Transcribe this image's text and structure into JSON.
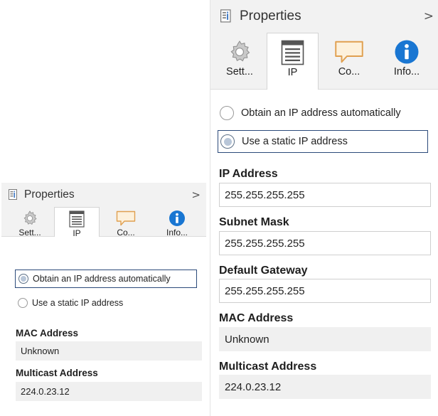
{
  "panels": {
    "small": {
      "header": {
        "title": "Properties",
        "collapse_glyph": ">"
      },
      "tabs": [
        {
          "label": "Sett...",
          "icon": "gear-icon",
          "active": false
        },
        {
          "label": "IP",
          "icon": "ip-config-icon",
          "active": true
        },
        {
          "label": "Co...",
          "icon": "comment-icon",
          "active": false
        },
        {
          "label": "Info...",
          "icon": "info-icon",
          "active": false
        }
      ],
      "radios": {
        "automatic": {
          "label": "Obtain an IP address automatically",
          "checked": true
        },
        "static": {
          "label": "Use a static IP address",
          "checked": false
        }
      },
      "fields": {
        "mac_address": {
          "label": "MAC Address",
          "value": "Unknown"
        },
        "multicast_address": {
          "label": "Multicast Address",
          "value": "224.0.23.12"
        }
      }
    },
    "large": {
      "header": {
        "title": "Properties",
        "collapse_glyph": ">"
      },
      "tabs": [
        {
          "label": "Sett...",
          "icon": "gear-icon",
          "active": false
        },
        {
          "label": "IP",
          "icon": "ip-config-icon",
          "active": true
        },
        {
          "label": "Co...",
          "icon": "comment-icon",
          "active": false
        },
        {
          "label": "Info...",
          "icon": "info-icon",
          "active": false
        }
      ],
      "radios": {
        "automatic": {
          "label": "Obtain an IP address automatically",
          "checked": false
        },
        "static": {
          "label": "Use a static IP address",
          "checked": true
        }
      },
      "fields": {
        "ip_address": {
          "label": "IP Address",
          "value": "255.255.255.255"
        },
        "subnet_mask": {
          "label": "Subnet Mask",
          "value": "255.255.255.255"
        },
        "default_gateway": {
          "label": "Default Gateway",
          "value": "255.255.255.255"
        },
        "mac_address": {
          "label": "MAC Address",
          "value": "Unknown"
        },
        "multicast_address": {
          "label": "Multicast Address",
          "value": "224.0.23.12"
        }
      }
    }
  },
  "colors": {
    "header_bg": "#f2f2f2",
    "focus_border": "#2b4a7a",
    "radio_dot": "#b8c6d8",
    "readonly_bg": "#f0f0f0",
    "info_blue": "#1976d2",
    "comment_orange": "#e0a050",
    "comment_fill": "#fdf1dc",
    "edge_red": "#e03a3a"
  }
}
